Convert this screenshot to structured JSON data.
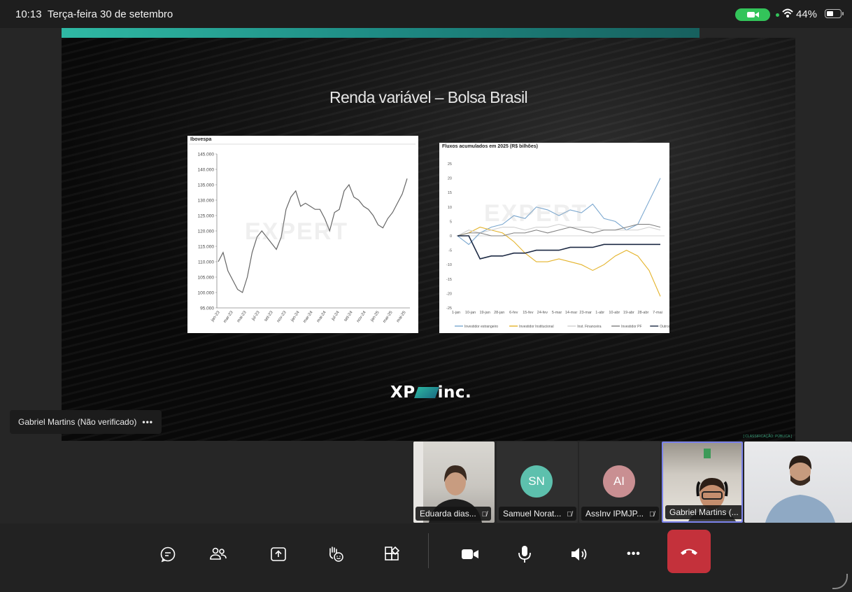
{
  "status_bar": {
    "time": "10:13",
    "date": "Terça-feira 30 de setembro",
    "battery": "44%"
  },
  "slide": {
    "title": "Renda variável – Bolsa Brasil",
    "logo_left": "XP",
    "logo_right": "inc.",
    "watermark": "EXPERT",
    "classification": "[ CLASSIFICAÇÃO: PÚBLICA ]"
  },
  "speaker_label": {
    "name": "Gabriel Martins (Não verificado)",
    "more": "•••"
  },
  "participants": [
    {
      "name": "Eduarda dias...",
      "type": "video"
    },
    {
      "name": "Samuel Norat...",
      "type": "avatar",
      "initials": "SN",
      "color": "#5dc0ad"
    },
    {
      "name": "AssInv IPMJP...",
      "type": "avatar",
      "initials": "AI",
      "color": "#c98f92"
    },
    {
      "name": "Gabriel Martins (...",
      "type": "video"
    },
    {
      "name": "",
      "type": "video"
    }
  ],
  "toolbar": {
    "buttons": [
      "chat-icon",
      "people-icon",
      "share-icon",
      "raise-hand-icon",
      "apps-icon",
      "camera-icon",
      "mic-icon",
      "speaker-icon",
      "more-icon",
      "hangup-icon"
    ],
    "more_label": "•••"
  },
  "chart_data": [
    {
      "type": "line",
      "title": "Ibovespa",
      "categories": [
        "jan-23",
        "mar-23",
        "mai-23",
        "jul-23",
        "set-23",
        "nov-23",
        "jan-24",
        "mar-24",
        "mai-24",
        "jul-24",
        "set-24",
        "nov-24",
        "jan-25",
        "mar-25",
        "mai-25"
      ],
      "y_ticks": [
        "95.000",
        "100.000",
        "105.000",
        "110.000",
        "115.000",
        "120.000",
        "125.000",
        "130.000",
        "135.000",
        "140.000",
        "145.000"
      ],
      "ylim": [
        95000,
        145000
      ],
      "series": [
        {
          "name": "",
          "color": "#666666",
          "values": [
            110000,
            113000,
            107000,
            104000,
            101000,
            100000,
            105000,
            113000,
            118000,
            120000,
            118000,
            116000,
            114000,
            118000,
            127000,
            131000,
            133000,
            128000,
            129000,
            128000,
            127000,
            127000,
            124000,
            120000,
            126000,
            127000,
            133000,
            135000,
            131000,
            130000,
            128000,
            127000,
            125000,
            122000,
            121000,
            124000,
            126000,
            129000,
            132000,
            137000
          ]
        }
      ]
    },
    {
      "type": "line",
      "title": "Fluxos acumulados em 2025 (R$ bilhões)",
      "x": [
        "1-jan",
        "10-jan",
        "19-jan",
        "28-jan",
        "6-fev",
        "15-fev",
        "24-fev",
        "5-mar",
        "14-mar",
        "23-mar",
        "1-abr",
        "10-abr",
        "19-abr",
        "28-abr",
        "7-mai"
      ],
      "y_ticks": [
        "25",
        "20",
        "15",
        "10",
        "5",
        "0",
        "-5",
        "-10",
        "-15",
        "-20",
        "-25"
      ],
      "ylim": [
        -25,
        25
      ],
      "series": [
        {
          "name": "Investidor estrangeiro",
          "color": "#7aa7cf",
          "values": [
            0,
            -3,
            1,
            3,
            4,
            7,
            6,
            10,
            9,
            7,
            9,
            8,
            11,
            6,
            5,
            2,
            4,
            12,
            20
          ]
        },
        {
          "name": "Investidor Institucional",
          "color": "#e4b32a",
          "values": [
            0,
            1,
            3,
            2,
            1,
            -2,
            -6,
            -9,
            -9,
            -8,
            -9,
            -10,
            -12,
            -10,
            -7,
            -5,
            -7,
            -12,
            -21
          ]
        },
        {
          "name": "Inst. Financeira",
          "color": "#cfcfcf",
          "values": [
            0,
            2,
            1,
            2,
            3,
            3,
            2,
            3,
            3,
            4,
            3,
            3,
            3,
            2,
            2,
            2,
            2,
            3,
            2
          ]
        },
        {
          "name": "Investidor PF",
          "color": "#808080",
          "values": [
            0,
            1,
            1,
            0,
            0,
            1,
            1,
            2,
            1,
            2,
            3,
            2,
            1,
            2,
            2,
            3,
            4,
            4,
            3
          ]
        },
        {
          "name": "Outros",
          "color": "#1d2a44",
          "values": [
            0,
            0,
            -8,
            -7,
            -7,
            -6,
            -6,
            -5,
            -5,
            -5,
            -4,
            -4,
            -4,
            -3,
            -3,
            -3,
            -3,
            -3,
            -3
          ]
        }
      ]
    }
  ]
}
